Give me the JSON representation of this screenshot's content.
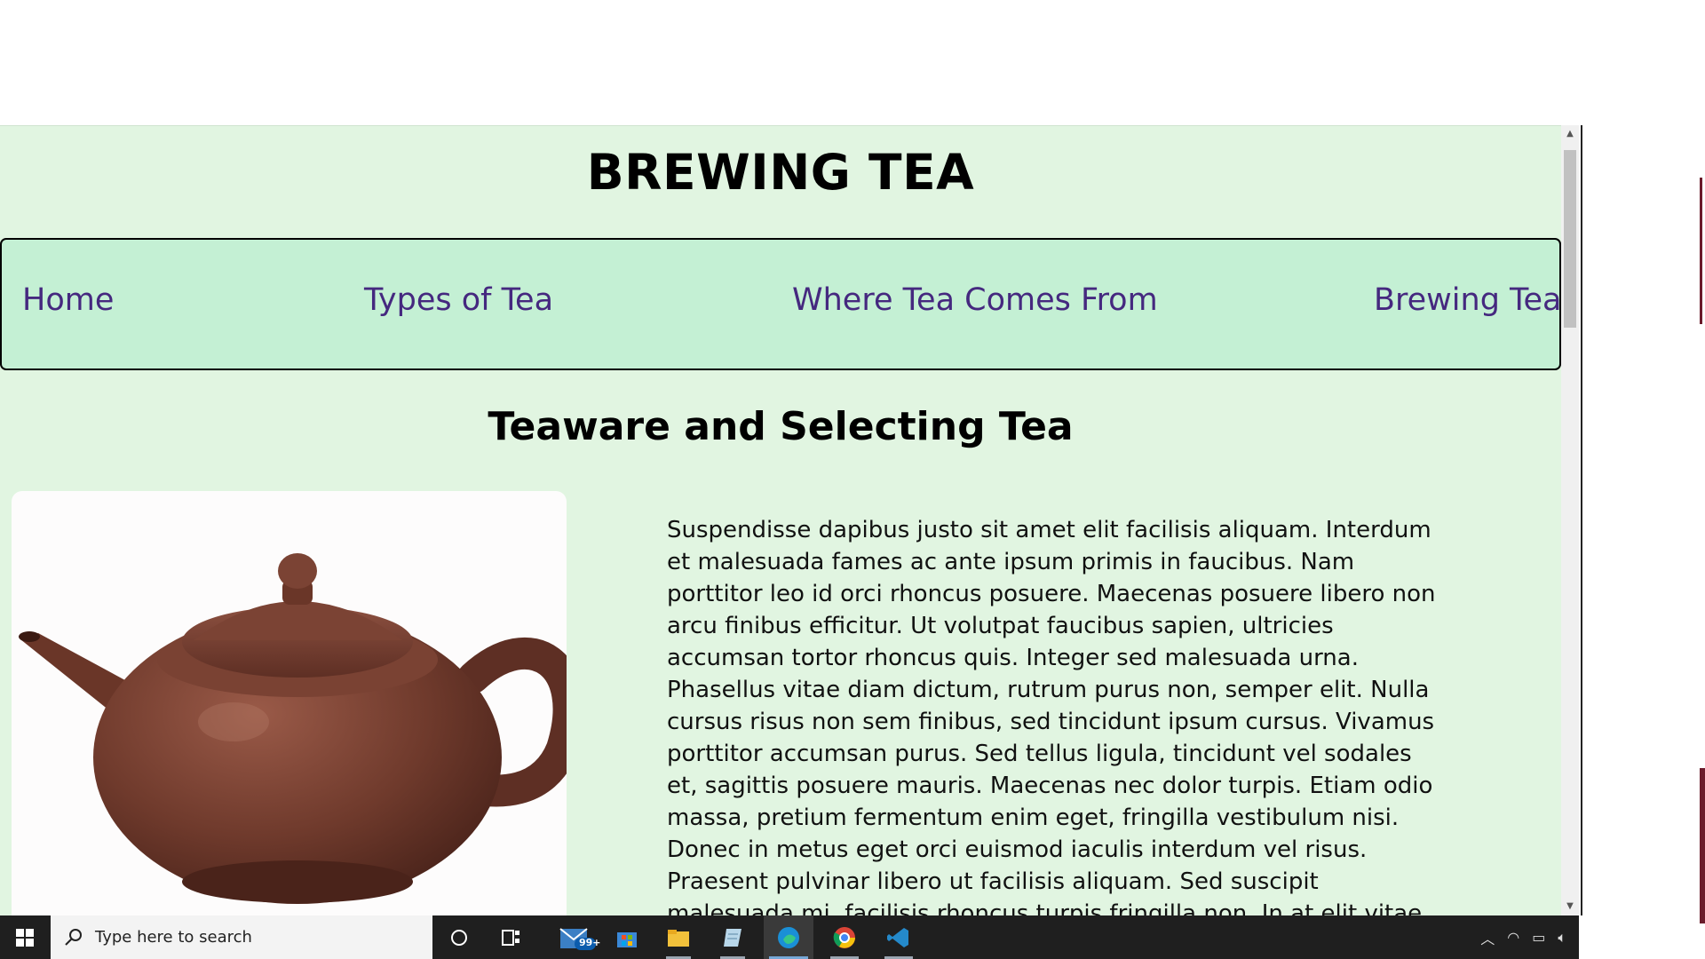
{
  "page": {
    "title": "BREWING TEA",
    "nav": [
      {
        "label": "Home"
      },
      {
        "label": "Types of Tea"
      },
      {
        "label": "Where Tea Comes From"
      },
      {
        "label": "Brewing Tea"
      }
    ],
    "section_heading": "Teaware and Selecting Tea",
    "image_alt": "teapot-image",
    "body_text": "Suspendisse dapibus justo sit amet elit facilisis aliquam. Interdum et malesuada fames ac ante ipsum primis in faucibus. Nam porttitor leo id orci rhoncus posuere. Maecenas posuere libero non arcu finibus efficitur. Ut volutpat faucibus sapien, ultricies accumsan tortor rhoncus quis. Integer sed malesuada urna. Phasellus vitae diam dictum, rutrum purus non, semper elit. Nulla cursus risus non sem finibus, sed tincidunt ipsum cursus. Vivamus porttitor accumsan purus. Sed tellus ligula, tincidunt vel sodales et, sagittis posuere mauris. Maecenas nec dolor turpis. Etiam odio massa, pretium fermentum enim eget, fringilla vestibulum nisi. Donec in metus eget orci euismod iaculis interdum vel risus. Praesent pulvinar libero ut facilisis aliquam. Sed suscipit malesuada mi, facilisis rhoncus turpis fringilla non. In at elit vitae nibh tincidunt volutpat ut vel risus. Praesent elit felis, commodo quis laoreet"
  },
  "colors": {
    "page_bg": "#e1f5e1",
    "nav_bg": "#c4f0d4",
    "link": "#45287f"
  },
  "taskbar": {
    "search_placeholder": "Type here to search",
    "mail_badge": "99+",
    "apps": [
      "cortana-icon",
      "task-view-icon",
      "mail-icon",
      "store-icon",
      "file-explorer-icon",
      "notepad-icon",
      "edge-icon",
      "chrome-icon",
      "vscode-icon"
    ],
    "tray_icons": [
      "chevron-up-icon",
      "network-icon",
      "battery-icon",
      "volume-icon"
    ]
  }
}
